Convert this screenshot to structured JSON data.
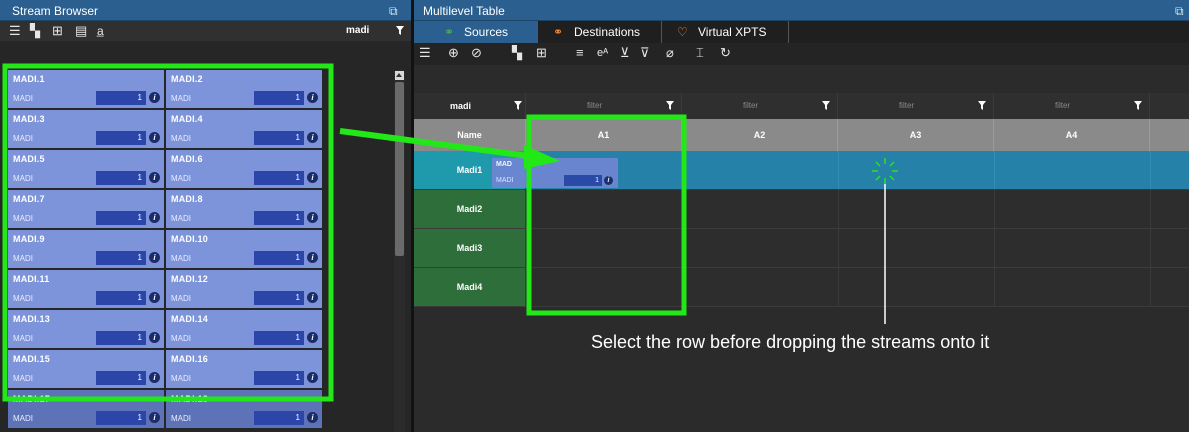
{
  "stream_browser": {
    "title": "Stream Browser",
    "filter_text": "madi",
    "cards": [
      {
        "name": "MADI.1",
        "type": "MADI",
        "value": "1"
      },
      {
        "name": "MADI.2",
        "type": "MADI",
        "value": "1"
      },
      {
        "name": "MADI.3",
        "type": "MADI",
        "value": "1"
      },
      {
        "name": "MADI.4",
        "type": "MADI",
        "value": "1"
      },
      {
        "name": "MADI.5",
        "type": "MADI",
        "value": "1"
      },
      {
        "name": "MADI.6",
        "type": "MADI",
        "value": "1"
      },
      {
        "name": "MADI.7",
        "type": "MADI",
        "value": "1"
      },
      {
        "name": "MADI.8",
        "type": "MADI",
        "value": "1"
      },
      {
        "name": "MADI.9",
        "type": "MADI",
        "value": "1"
      },
      {
        "name": "MADI.10",
        "type": "MADI",
        "value": "1"
      },
      {
        "name": "MADI.11",
        "type": "MADI",
        "value": "1"
      },
      {
        "name": "MADI.12",
        "type": "MADI",
        "value": "1"
      },
      {
        "name": "MADI.13",
        "type": "MADI",
        "value": "1"
      },
      {
        "name": "MADI.14",
        "type": "MADI",
        "value": "1"
      },
      {
        "name": "MADI.15",
        "type": "MADI",
        "value": "1"
      },
      {
        "name": "MADI.16",
        "type": "MADI",
        "value": "1"
      },
      {
        "name": "MADI.17",
        "type": "MADI",
        "value": "1"
      },
      {
        "name": "MADI.18",
        "type": "MADI",
        "value": "1"
      }
    ]
  },
  "multilevel_table": {
    "title": "Multilevel Table",
    "tabs": [
      {
        "label": "Sources",
        "icon": "sources-icon",
        "active": true
      },
      {
        "label": "Destinations",
        "icon": "destinations-icon",
        "active": false
      },
      {
        "label": "Virtual XPTS",
        "icon": "virtual-xpts-icon",
        "active": false
      }
    ],
    "filters": [
      "madi",
      "filter",
      "filter",
      "filter",
      "filter"
    ],
    "columns": [
      "Name",
      "A1",
      "A2",
      "A3",
      "A4"
    ],
    "rows": [
      {
        "name": "Madi1",
        "selected": true
      },
      {
        "name": "Madi2",
        "selected": false
      },
      {
        "name": "Madi3",
        "selected": false
      },
      {
        "name": "Madi4",
        "selected": false
      }
    ],
    "drag_preview": {
      "name": "MAD",
      "type": "MADI",
      "value": "1"
    }
  },
  "annotation": {
    "caption": "Select the row before dropping the streams onto it",
    "highlight_color": "#22e818"
  },
  "colors": {
    "title_bar": "#2a5f8f",
    "card": "#7d94da",
    "selected_row": "#2581a8",
    "row_name": "#2d6e3b"
  }
}
